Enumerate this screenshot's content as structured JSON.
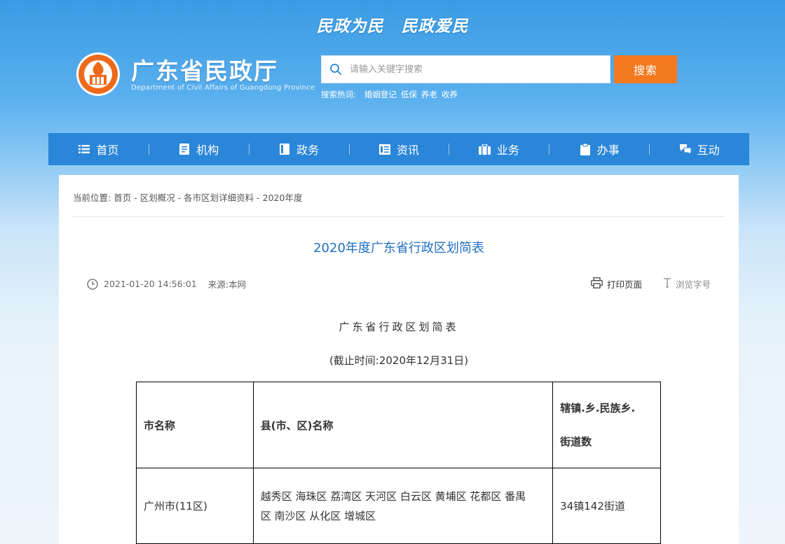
{
  "header": {
    "slogan_left": "民政为民",
    "slogan_right": "民政爱民",
    "site_title": "广东省民政厅",
    "site_subtitle": "Department of Civil Affairs of Guangdong Province"
  },
  "search": {
    "placeholder": "请输入关键字搜索",
    "button_label": "搜索",
    "hot_label": "搜索热词:",
    "hot_terms": [
      "婚姻登记",
      "低保",
      "养老",
      "收养"
    ]
  },
  "nav": {
    "items": [
      {
        "label": "首页",
        "icon": "list-icon"
      },
      {
        "label": "机构",
        "icon": "document-icon"
      },
      {
        "label": "政务",
        "icon": "book-icon"
      },
      {
        "label": "资讯",
        "icon": "news-icon"
      },
      {
        "label": "业务",
        "icon": "briefcase-icon"
      },
      {
        "label": "办事",
        "icon": "clipboard-icon"
      },
      {
        "label": "互动",
        "icon": "chat-icon"
      }
    ]
  },
  "breadcrumb": {
    "label": "当前位置:",
    "path": [
      "首页",
      "区划概况",
      "各市区划详细资料",
      "2020年度"
    ]
  },
  "article": {
    "title": "2020年度广东省行政区划简表",
    "datetime": "2021-01-20 14:56:01",
    "source": "来源:本网",
    "print_label": "打印页面",
    "font_label": "浏览字号",
    "body_title": "广东省行政区划简表",
    "body_date": "(截止时间:2020年12月31日)"
  },
  "table": {
    "headers": [
      "市名称",
      "县(市、区)名称",
      "辖镇.乡.民族乡.",
      "街道数"
    ],
    "rows": [
      {
        "city": "广州市(11区)",
        "districts_line1": "越秀区 海珠区 荔湾区 天河区 白云区 黄埔区 花都区 番禺",
        "districts_line2": "区 南沙区 从化区 增城区",
        "counts": "34镇142街道"
      }
    ]
  },
  "colors": {
    "nav_bg": "#2a86d8",
    "search_button": "#f5791f",
    "title_blue": "#1f6fc2",
    "logo_orange": "#ee6a1a"
  }
}
